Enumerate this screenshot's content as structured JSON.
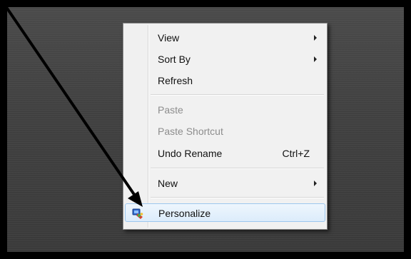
{
  "context_menu": {
    "items": [
      {
        "label": "View",
        "submenu": true
      },
      {
        "label": "Sort By",
        "submenu": true
      },
      {
        "label": "Refresh"
      },
      {
        "label": "Paste",
        "disabled": true
      },
      {
        "label": "Paste Shortcut",
        "disabled": true
      },
      {
        "label": "Undo Rename",
        "shortcut": "Ctrl+Z"
      },
      {
        "label": "New",
        "submenu": true
      },
      {
        "label": "Personalize",
        "icon": "personalize-icon",
        "highlighted": true
      }
    ]
  },
  "annotation": {
    "type": "arrow",
    "color": "#000000",
    "points_to": "Personalize"
  },
  "colors": {
    "desktop_background": "#424242",
    "menu_background": "#f1f1f1",
    "highlight_border": "#9cc7ee",
    "disabled_text": "#8d8d8d"
  }
}
